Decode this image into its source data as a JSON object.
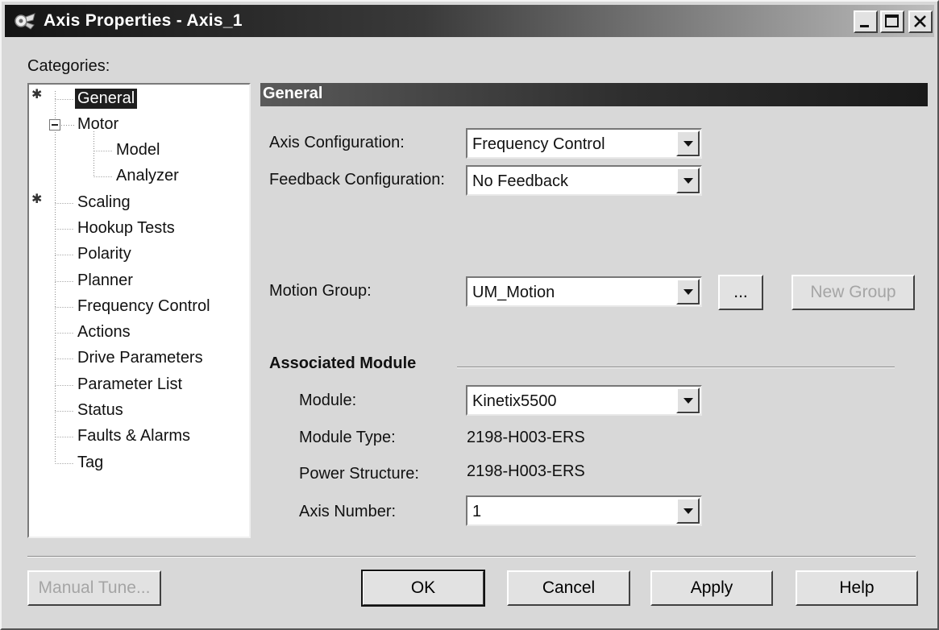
{
  "window": {
    "title": "Axis Properties - Axis_1"
  },
  "categories": {
    "label": "Categories:",
    "items": [
      {
        "label": "General",
        "starred": true,
        "selected": true
      },
      {
        "label": "Motor"
      },
      {
        "label": "Model"
      },
      {
        "label": "Analyzer"
      },
      {
        "label": "Scaling",
        "starred": true
      },
      {
        "label": "Hookup Tests"
      },
      {
        "label": "Polarity"
      },
      {
        "label": "Planner"
      },
      {
        "label": "Frequency Control"
      },
      {
        "label": "Actions"
      },
      {
        "label": "Drive Parameters"
      },
      {
        "label": "Parameter List"
      },
      {
        "label": "Status"
      },
      {
        "label": "Faults & Alarms"
      },
      {
        "label": "Tag"
      }
    ]
  },
  "general": {
    "header": "General",
    "axis_configuration": {
      "label": "Axis Configuration:",
      "value": "Frequency Control"
    },
    "feedback_configuration": {
      "label": "Feedback Configuration:",
      "value": "No Feedback"
    },
    "motion_group": {
      "label": "Motion Group:",
      "value": "UM_Motion",
      "browse_label": "...",
      "new_group_label": "New Group"
    },
    "associated_module": {
      "heading": "Associated Module",
      "module": {
        "label": "Module:",
        "value": "Kinetix5500"
      },
      "module_type": {
        "label": "Module Type:",
        "value": "2198-H003-ERS"
      },
      "power_structure": {
        "label": "Power Structure:",
        "value": "2198-H003-ERS"
      },
      "axis_number": {
        "label": "Axis Number:",
        "value": "1"
      }
    }
  },
  "buttons": {
    "manual_tune": "Manual Tune...",
    "ok": "OK",
    "cancel": "Cancel",
    "apply": "Apply",
    "help": "Help"
  }
}
